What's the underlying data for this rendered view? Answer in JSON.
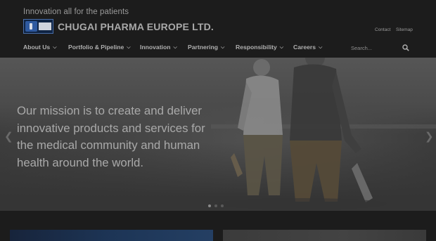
{
  "header": {
    "tagline": "Innovation all for the patients",
    "company_name": "CHUGAI PHARMA EUROPE LTD.",
    "logo_icon": "chugai-logo",
    "utility_links": [
      {
        "label": "Contact"
      },
      {
        "label": "Sitemap"
      }
    ]
  },
  "nav": {
    "items": [
      {
        "label": "About Us"
      },
      {
        "label": "Portfolio & Pipeline"
      },
      {
        "label": "Innovation"
      },
      {
        "label": "Partnering"
      },
      {
        "label": "Responsibility"
      },
      {
        "label": "Careers"
      }
    ],
    "chevron_icon": "chevron-down-icon",
    "search": {
      "placeholder": "Search...",
      "icon": "search-icon"
    }
  },
  "hero": {
    "lines": [
      "Our mission is to create and deliver",
      "innovative products and services for",
      "the medical community and human",
      "health around the world."
    ],
    "prev_icon": "chevron-left-icon",
    "next_icon": "chevron-right-icon",
    "slide_count": 3,
    "active_slide": 1
  },
  "colors": {
    "background": "#1c1c1c",
    "text_muted": "#a9a9a9",
    "logo_blue": "#2f5aa0"
  }
}
